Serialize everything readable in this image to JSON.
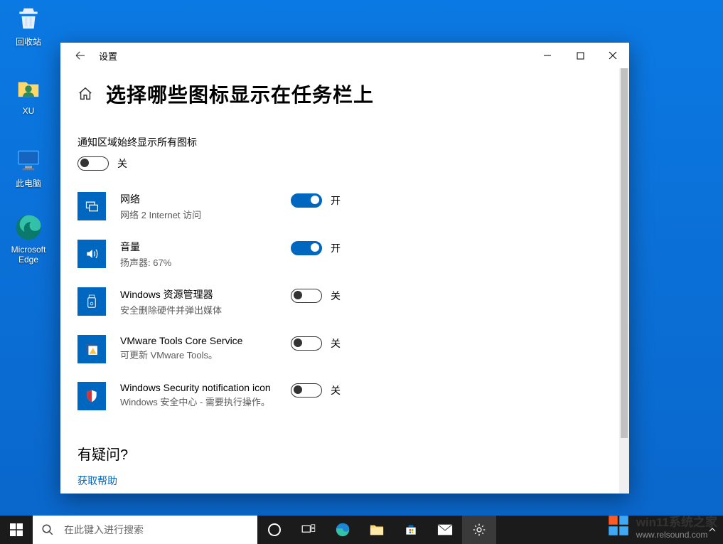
{
  "desktop": {
    "icons": [
      {
        "name": "回收站"
      },
      {
        "name": "XU"
      },
      {
        "name": "此电脑"
      },
      {
        "name": "Microsoft Edge"
      }
    ]
  },
  "window": {
    "app_title": "设置",
    "page_title": "选择哪些图标显示在任务栏上",
    "master_toggle_label": "通知区域始终显示所有图标",
    "state_on": "开",
    "state_off": "关",
    "items": [
      {
        "title": "网络",
        "subtitle": "网络 2 Internet 访问",
        "on": true
      },
      {
        "title": "音量",
        "subtitle": "扬声器: 67%",
        "on": true
      },
      {
        "title": "Windows 资源管理器",
        "subtitle": "安全删除硬件并弹出媒体",
        "on": false
      },
      {
        "title": "VMware Tools Core Service",
        "subtitle": "可更新 VMware Tools。",
        "on": false
      },
      {
        "title": "Windows Security notification icon",
        "subtitle": "Windows 安全中心 - 需要执行操作。",
        "on": false
      }
    ],
    "question_heading": "有疑问?",
    "help_link": "获取帮助"
  },
  "taskbar": {
    "search_placeholder": "在此键入进行搜索"
  },
  "watermark": {
    "main": "win11系统之家",
    "sub": "www.relsound.com"
  }
}
